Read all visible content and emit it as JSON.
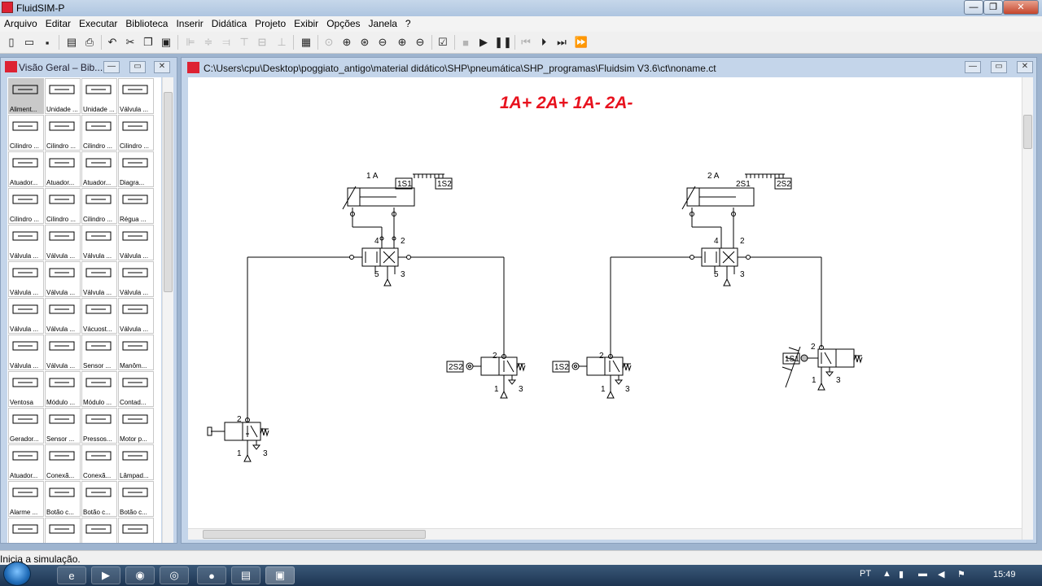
{
  "app": {
    "title": "FluidSIM-P"
  },
  "menu": [
    "Arquivo",
    "Editar",
    "Executar",
    "Biblioteca",
    "Inserir",
    "Didática",
    "Projeto",
    "Exibir",
    "Opções",
    "Janela",
    "?"
  ],
  "library": {
    "title": "Visão Geral – Bib...",
    "items": [
      "Aliment...",
      "Unidade ...",
      "Unidade ...",
      "Válvula ...",
      "Cilindro ...",
      "Cilindro ...",
      "Cilindro ...",
      "Cilindro ...",
      "Atuador...",
      "Atuador...",
      "Atuador...",
      "Diagra...",
      "Cilindro ...",
      "Cilindro ...",
      "Cilindro ...",
      "Régua ...",
      "Válvula ...",
      "Válvula ...",
      "Válvula ...",
      "Válvula ...",
      "Válvula ...",
      "Válvula ...",
      "Válvula ...",
      "Válvula ...",
      "Válvula ...",
      "Válvula ...",
      "Vácuost...",
      "Válvula ...",
      "Válvula ...",
      "Válvula ...",
      "Sensor ...",
      "Manôm...",
      "Ventosa",
      "Módulo ...",
      "Módulo ...",
      "Contad...",
      "Gerador...",
      "Sensor ...",
      "Pressos...",
      "Motor p...",
      "Atuador...",
      "Conexã...",
      "Conexã...",
      "Lâmpad...",
      "Alarme ...",
      "Botão c...",
      "Botão c...",
      "Botão c...",
      "",
      "",
      "",
      ""
    ]
  },
  "circuit_window": {
    "path": "C:\\Users\\cpu\\Desktop\\poggiato_antigo\\material didático\\SHP\\pneumática\\SHP_programas\\Fluidsim V3.6\\ct\\noname.ct",
    "sequence_title": "1A+ 2A+ 1A- 2A-",
    "labels": {
      "cyl1": "1 A",
      "cyl2": "2 A",
      "s_1S1": "1S1",
      "s_1S2": "1S2",
      "s_2S1": "2S1",
      "s_2S2": "2S2",
      "p4": "4",
      "p2": "2",
      "p5": "5",
      "p3": "3",
      "p1": "1"
    },
    "accent_color": "#e8121e"
  },
  "status": "Inicia a simulação.",
  "taskbar": {
    "lang": "PT",
    "time": "15:49"
  }
}
